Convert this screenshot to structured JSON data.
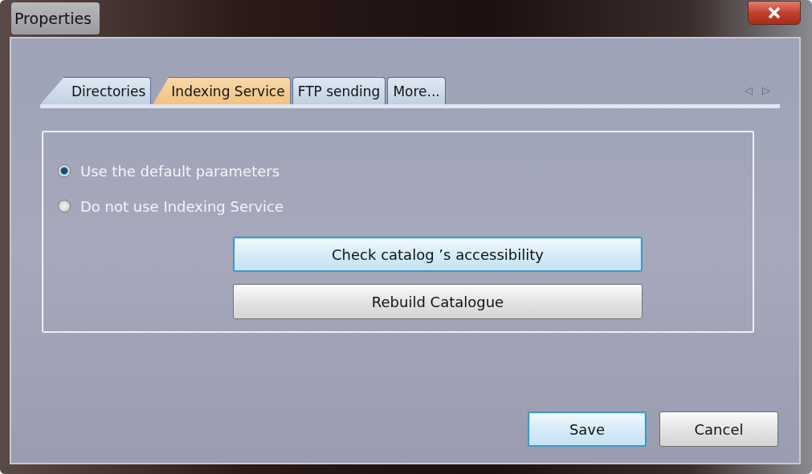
{
  "window": {
    "title": "Properties"
  },
  "tabs": [
    {
      "label": "Directories",
      "selected": false
    },
    {
      "label": "Indexing Service",
      "selected": true
    },
    {
      "label": "FTP sending",
      "selected": false
    },
    {
      "label": "More...",
      "selected": false
    }
  ],
  "scroll_arrows": [
    "◁",
    "▷"
  ],
  "options": [
    {
      "label": "Use the default parameters",
      "selected": true
    },
    {
      "label": "Do not use Indexing Service",
      "selected": false
    }
  ],
  "panel_buttons": [
    {
      "label": "Check catalog ’s accessibility",
      "focused": true
    },
    {
      "label": "Rebuild Catalogue",
      "focused": false
    }
  ],
  "footer_buttons": [
    {
      "label": "Save",
      "focused": true
    },
    {
      "label": "Cancel",
      "focused": false
    }
  ]
}
